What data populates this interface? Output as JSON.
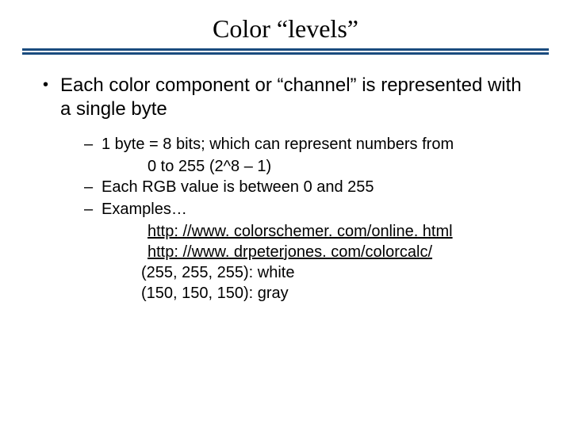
{
  "title": "Color “levels”",
  "main_bullet": "Each color component or “channel” is represented with a single byte",
  "sub": {
    "b1_line1": "1 byte = 8 bits; which can represent numbers from",
    "b1_line2": "0 to 255 (2^8 – 1)",
    "b2": "Each RGB value is between 0 and 255",
    "b3": "Examples…",
    "link1": "http: //www. colorschemer. com/online. html",
    "link2": "http: //www. drpeterjones. com/colorcalc/",
    "ex1": "(255, 255, 255): white",
    "ex2": "(150, 150, 150): gray"
  }
}
